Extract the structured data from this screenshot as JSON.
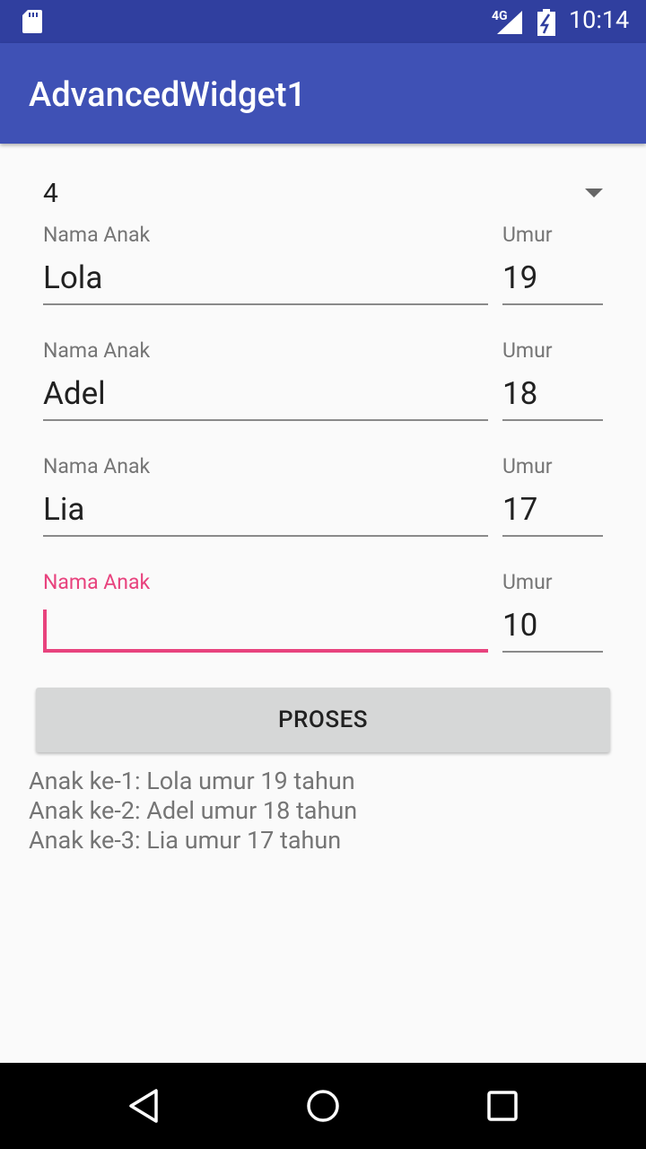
{
  "status_bar": {
    "network": "4G",
    "time": "10:14"
  },
  "app_bar": {
    "title": "AdvancedWidget1"
  },
  "spinner": {
    "value": "4",
    "icon": "dropdown-arrow-icon"
  },
  "children": [
    {
      "name_label": "Nama Anak",
      "name": "Lola",
      "age_label": "Umur",
      "age": "19"
    },
    {
      "name_label": "Nama Anak",
      "name": "Adel",
      "age_label": "Umur",
      "age": "18"
    },
    {
      "name_label": "Nama Anak",
      "name": "Lia",
      "age_label": "Umur",
      "age": "17"
    },
    {
      "name_label": "Nama Anak",
      "name": "",
      "age_label": "Umur",
      "age": "10"
    }
  ],
  "process_button": {
    "label": "PROSES"
  },
  "results": [
    "Anak ke-1: Lola umur 19 tahun",
    "Anak ke-2: Adel umur 18 tahun",
    "Anak ke-3: Lia umur 17 tahun"
  ],
  "colors": {
    "primary": "#3f51b5",
    "primary_dark": "#303f9f",
    "accent": "#e8437e"
  }
}
